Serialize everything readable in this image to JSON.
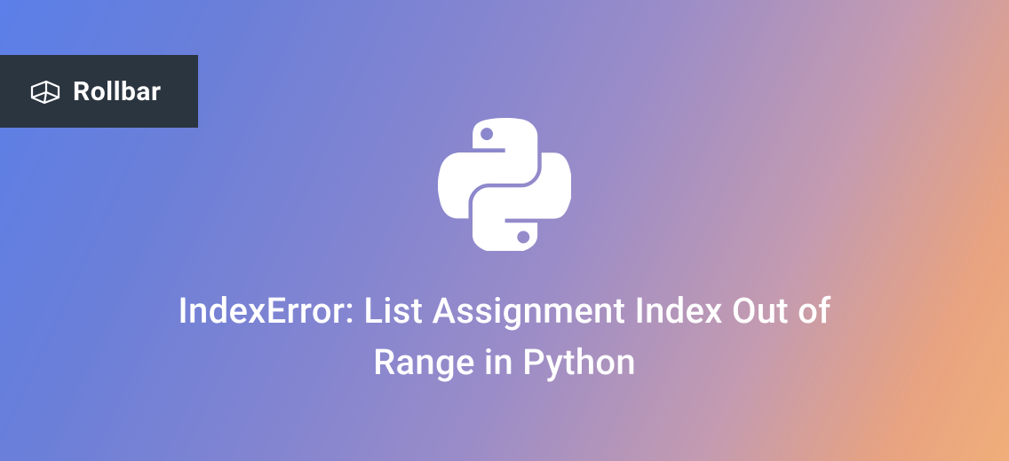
{
  "logo": {
    "brand_name": "Rollbar"
  },
  "hero": {
    "title": "IndexError: List Assignment Index Out of Range in Python",
    "icon_name": "python-logo"
  },
  "colors": {
    "badge_bg": "#2b3540",
    "text": "#ffffff"
  }
}
